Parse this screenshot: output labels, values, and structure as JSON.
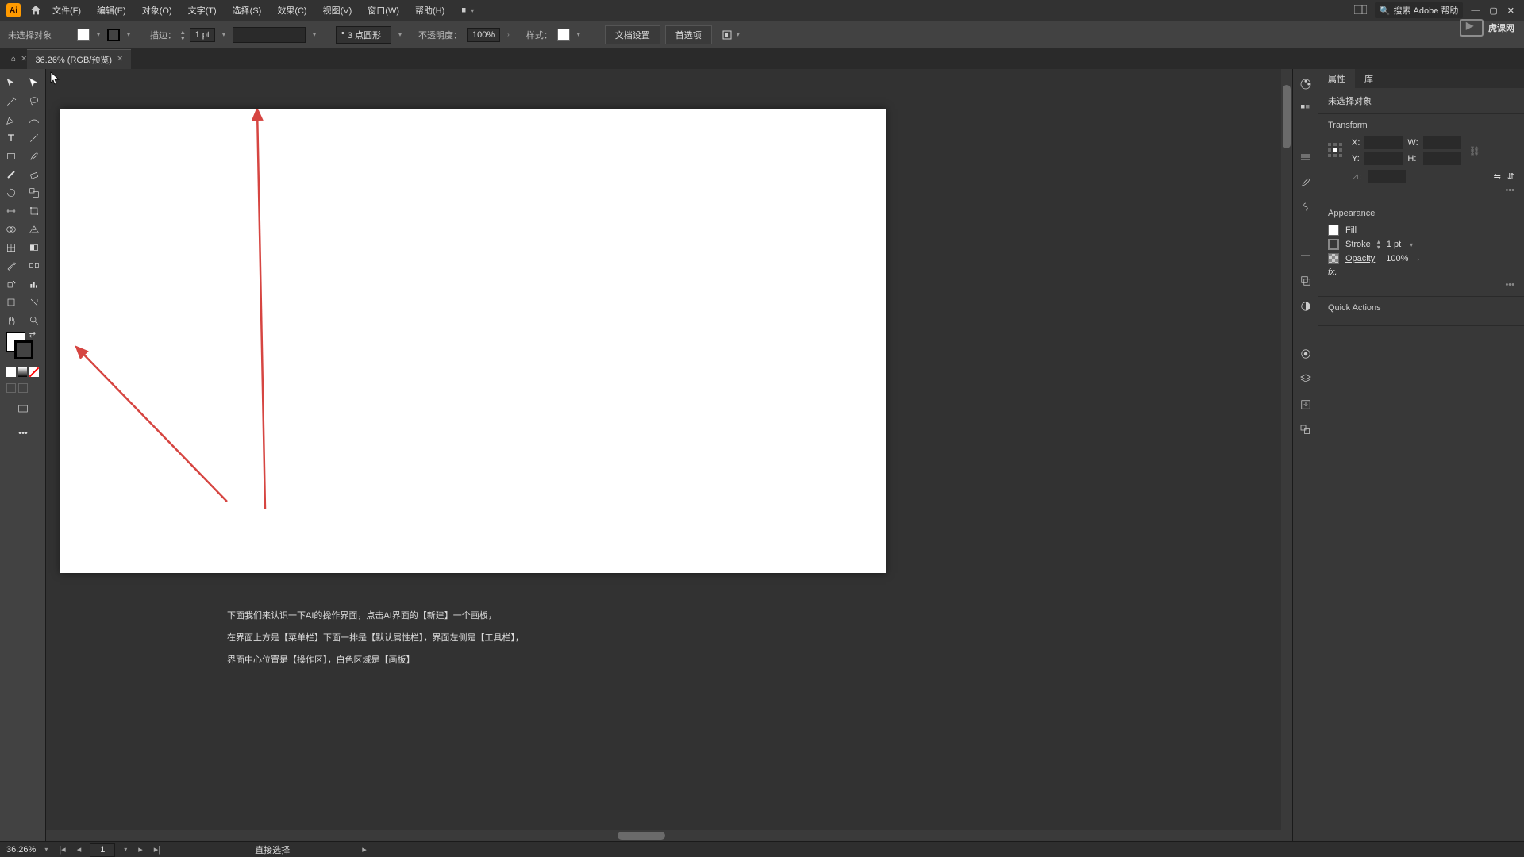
{
  "menu": {
    "file": "文件(F)",
    "edit": "编辑(E)",
    "object": "对象(O)",
    "type": "文字(T)",
    "select": "选择(S)",
    "effect": "效果(C)",
    "view": "视图(V)",
    "window": "窗口(W)",
    "help": "帮助(H)"
  },
  "search_placeholder": "搜索 Adobe 帮助",
  "optionbar": {
    "no_selection": "未选择对象",
    "stroke_label": "描边：",
    "stroke_weight": "1 pt",
    "brush_preset": "3 点圆形",
    "opacity_label": "不透明度：",
    "opacity_value": "100%",
    "style_label": "样式：",
    "doc_setup": "文档设置",
    "prefs": "首选项"
  },
  "doc_tab": "36.26% (RGB/预览)",
  "statusbar": {
    "zoom": "36.26%",
    "artboard": "1",
    "tool": "直接选择"
  },
  "panels": {
    "tab_props": "属性",
    "tab_lib": "库",
    "no_selection": "未选择对象",
    "transform": "Transform",
    "appearance": "Appearance",
    "fill": "Fill",
    "stroke": "Stroke",
    "opacity": "Opacity",
    "stroke_val": "1 pt",
    "opacity_val": "100%",
    "quick_actions": "Quick Actions",
    "x": "X:",
    "y": "Y:",
    "w": "W:",
    "h": "H:",
    "angle": "⊿:",
    "fx": "fx."
  },
  "annotation": {
    "l1": "下面我们来认识一下AI的操作界面，点击AI界面的【新建】一个画板，",
    "l2": "在界面上方是【菜单栏】下面一排是【默认属性栏】，界面左侧是【工具栏】，",
    "l3": "界面中心位置是【操作区】，白色区域是【画板】"
  },
  "watermark": "虎课网",
  "dot": "•"
}
